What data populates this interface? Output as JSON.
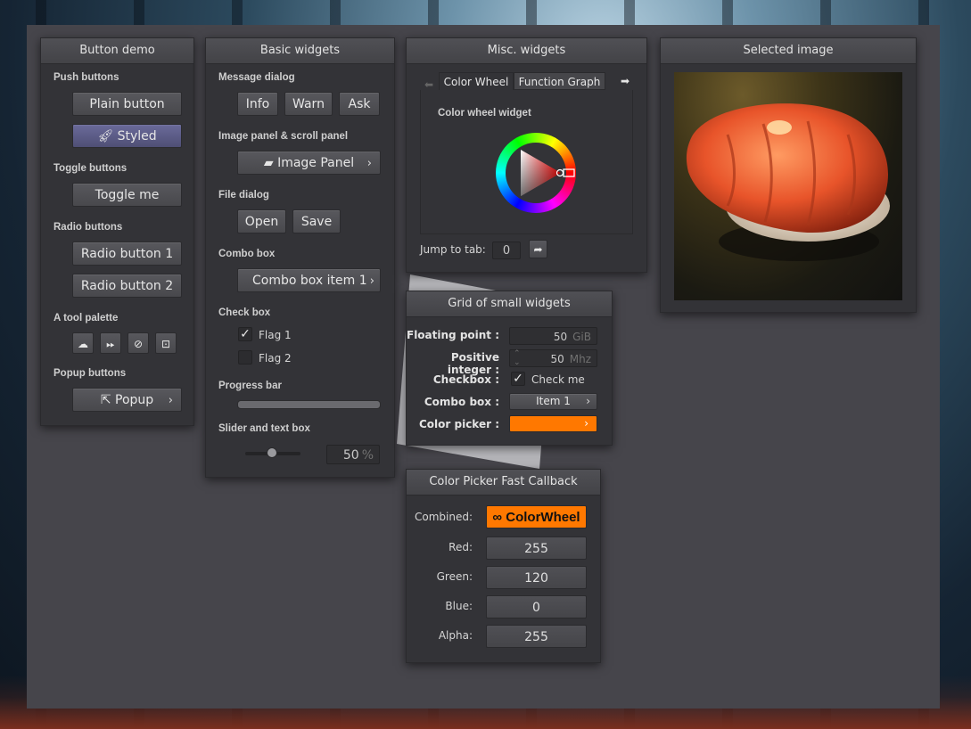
{
  "colors": {
    "accent_orange": "#ff7800",
    "panel": "#333337",
    "styled_button": "#5b5b88"
  },
  "button_demo": {
    "title": "Button demo",
    "push_label": "Push buttons",
    "plain": "Plain button",
    "styled": "Styled",
    "toggle_label": "Toggle buttons",
    "toggle": "Toggle me",
    "radio_label": "Radio buttons",
    "radio1": "Radio button 1",
    "radio2": "Radio button 2",
    "palette_label": "A tool palette",
    "popup_label": "Popup buttons",
    "popup": "Popup"
  },
  "basic": {
    "title": "Basic widgets",
    "message_label": "Message dialog",
    "info": "Info",
    "warn": "Warn",
    "ask": "Ask",
    "image_label": "Image panel & scroll panel",
    "image_panel": "Image Panel",
    "file_label": "File dialog",
    "open": "Open",
    "save": "Save",
    "combo_label": "Combo box",
    "combo_value": "Combo box item 1",
    "check_label": "Check box",
    "flag1": "Flag 1",
    "flag2": "Flag 2",
    "flag1_checked": true,
    "flag2_checked": false,
    "progress_label": "Progress bar",
    "progress": 0.0,
    "slider_label": "Slider and text box",
    "slider_value": "50",
    "slider_unit": "%",
    "slider_fraction": 0.5
  },
  "misc": {
    "title": "Misc. widgets",
    "tab1": "Color Wheel",
    "tab2": "Function Graph",
    "wheel_label": "Color wheel widget",
    "jump_label": "Jump to tab:",
    "jump_value": "0"
  },
  "selected": {
    "title": "Selected image"
  },
  "grid": {
    "title": "Grid of small widgets",
    "float_label": "Floating point :",
    "float_value": "50",
    "float_unit": "GiB",
    "int_label": "Positive integer :",
    "int_value": "50",
    "int_unit": "Mhz",
    "check_label": "Checkbox :",
    "check_text": "Check me",
    "combo_label": "Combo box :",
    "combo_value": "Item 1",
    "color_label": "Color picker :"
  },
  "picker": {
    "title": "Color Picker Fast Callback",
    "combined_label": "Combined:",
    "combined_value": "ColorWheel",
    "red_label": "Red:",
    "red": "255",
    "green_label": "Green:",
    "green": "120",
    "blue_label": "Blue:",
    "blue": "0",
    "alpha_label": "Alpha:",
    "alpha": "255"
  }
}
